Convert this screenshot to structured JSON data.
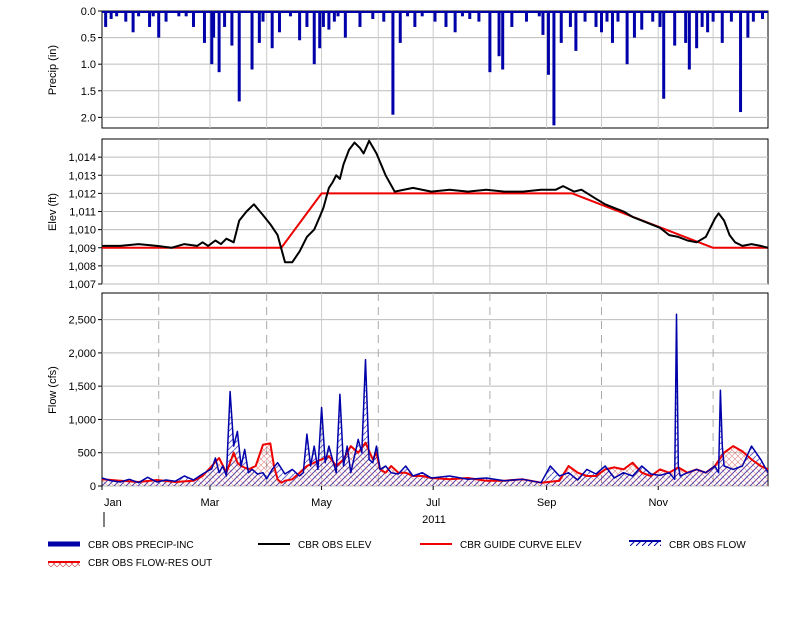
{
  "chart_data": [
    {
      "type": "bar",
      "panel": "precip",
      "ylabel": "Precip (in)",
      "ylim": [
        0,
        2.2
      ],
      "y_inverted": true,
      "yticks": [
        "0.0",
        "0.5",
        "1.0",
        "1.5",
        "2.0"
      ],
      "ytick_values": [
        0,
        0.5,
        1.0,
        1.5,
        2.0
      ],
      "series": [
        {
          "name": "CBR OBS PRECIP-INC",
          "color": "#0000aa",
          "x_day": [
            2,
            5,
            8,
            13,
            17,
            20,
            26,
            28,
            31,
            35,
            42,
            46,
            50,
            56,
            60,
            61,
            64,
            67,
            71,
            75,
            82,
            86,
            88,
            93,
            97,
            103,
            108,
            112,
            116,
            119,
            121,
            124,
            127,
            129,
            133,
            141,
            148,
            154,
            159,
            163,
            167,
            171,
            175,
            182,
            188,
            193,
            197,
            201,
            206,
            212,
            217,
            219,
            224,
            232,
            239,
            241,
            244,
            247,
            251,
            256,
            259,
            264,
            270,
            273,
            276,
            279,
            282,
            287,
            291,
            295,
            301,
            305,
            307,
            313,
            319,
            321,
            325,
            328,
            331,
            334,
            339,
            344,
            349,
            353,
            356,
            361
          ],
          "values": [
            0.3,
            0.15,
            0.1,
            0.2,
            0.4,
            0.1,
            0.3,
            0.1,
            0.5,
            0.2,
            0.1,
            0.1,
            0.3,
            0.6,
            1.0,
            0.5,
            1.15,
            0.3,
            0.65,
            1.7,
            1.1,
            0.6,
            0.2,
            0.7,
            0.4,
            0.1,
            0.55,
            0.3,
            1.0,
            0.7,
            0.3,
            0.35,
            0.2,
            0.1,
            0.5,
            0.3,
            0.15,
            0.2,
            1.95,
            0.6,
            0.1,
            0.3,
            0.1,
            0.2,
            0.3,
            0.4,
            0.1,
            0.15,
            0.2,
            1.15,
            0.85,
            1.1,
            0.3,
            0.2,
            0.1,
            0.45,
            1.2,
            2.15,
            0.6,
            0.3,
            0.75,
            0.2,
            0.3,
            0.4,
            0.2,
            0.6,
            0.2,
            1.0,
            0.5,
            0.35,
            0.2,
            0.3,
            1.65,
            0.65,
            0.6,
            1.1,
            0.7,
            0.3,
            0.4,
            0.2,
            0.6,
            0.2,
            1.9,
            0.5,
            0.2,
            0.15
          ]
        }
      ]
    },
    {
      "type": "line",
      "panel": "elev",
      "ylabel": "Elev (ft)",
      "ylim": [
        1007,
        1015
      ],
      "yticks": [
        "1,007",
        "1,008",
        "1,009",
        "1,010",
        "1,011",
        "1,012",
        "1,013",
        "1,014"
      ],
      "ytick_values": [
        1007,
        1008,
        1009,
        1010,
        1011,
        1012,
        1013,
        1014
      ],
      "series": [
        {
          "name": "CBR OBS ELEV",
          "color": "#000000",
          "x_day": [
            0,
            10,
            20,
            30,
            38,
            45,
            52,
            55,
            58,
            62,
            65,
            68,
            72,
            75,
            79,
            83,
            88,
            92,
            96,
            100,
            104,
            108,
            112,
            116,
            119,
            121,
            124,
            126,
            128,
            130,
            132,
            135,
            138,
            141,
            143,
            146,
            150,
            155,
            160,
            170,
            180,
            190,
            200,
            210,
            220,
            230,
            240,
            248,
            252,
            258,
            262,
            270,
            275,
            280,
            285,
            290,
            295,
            300,
            305,
            310,
            315,
            320,
            325,
            330,
            335,
            337,
            340,
            343,
            346,
            350,
            355,
            360,
            364
          ],
          "values": [
            1009.1,
            1009.1,
            1009.2,
            1009.1,
            1009.0,
            1009.2,
            1009.1,
            1009.3,
            1009.1,
            1009.4,
            1009.2,
            1009.5,
            1009.3,
            1010.5,
            1011.0,
            1011.4,
            1010.8,
            1010.3,
            1009.7,
            1008.2,
            1008.2,
            1008.8,
            1009.6,
            1010.0,
            1010.7,
            1011.2,
            1012.3,
            1012.6,
            1013.0,
            1012.8,
            1013.6,
            1014.4,
            1014.8,
            1014.5,
            1014.2,
            1014.9,
            1014.2,
            1013.0,
            1012.1,
            1012.3,
            1012.1,
            1012.2,
            1012.1,
            1012.2,
            1012.1,
            1012.1,
            1012.2,
            1012.2,
            1012.4,
            1012.1,
            1012.2,
            1011.7,
            1011.4,
            1011.2,
            1011.0,
            1010.7,
            1010.5,
            1010.3,
            1010.1,
            1009.7,
            1009.6,
            1009.4,
            1009.3,
            1009.6,
            1010.6,
            1010.9,
            1010.5,
            1009.7,
            1009.3,
            1009.1,
            1009.2,
            1009.1,
            1009.0
          ]
        },
        {
          "name": "CBR GUIDE CURVE ELEV",
          "color": "#ee0000",
          "x_day": [
            0,
            90,
            98,
            120,
            121,
            257,
            334,
            364
          ],
          "values": [
            1009,
            1009,
            1009,
            1012,
            1012,
            1012,
            1009,
            1009
          ]
        }
      ]
    },
    {
      "type": "line",
      "panel": "flow",
      "ylabel": "Flow (cfs)",
      "ylim": [
        0,
        2900
      ],
      "yticks": [
        "0",
        "500",
        "1,000",
        "1,500",
        "2,000",
        "2,500"
      ],
      "ytick_values": [
        0,
        500,
        1000,
        1500,
        2000,
        2500
      ],
      "xlabel": "2011",
      "xticks": [
        "Jan",
        "Mar",
        "May",
        "Jul",
        "Sep",
        "Nov"
      ],
      "xtick_days": [
        0,
        59,
        120,
        181,
        243,
        304
      ],
      "grid_days": [
        31,
        90,
        151,
        212,
        273,
        334
      ],
      "series": [
        {
          "name": "CBR OBS FLOW",
          "color": "#0000aa",
          "x_day": [
            0,
            5,
            10,
            15,
            20,
            25,
            30,
            35,
            40,
            45,
            50,
            55,
            60,
            62,
            64,
            66,
            68,
            70,
            72,
            74,
            76,
            78,
            80,
            82,
            85,
            88,
            90,
            93,
            96,
            100,
            104,
            108,
            110,
            112,
            114,
            116,
            118,
            120,
            122,
            124,
            126,
            128,
            130,
            132,
            134,
            136,
            138,
            140,
            142,
            144,
            146,
            148,
            150,
            152,
            155,
            158,
            162,
            166,
            170,
            175,
            180,
            190,
            200,
            210,
            220,
            230,
            240,
            245,
            250,
            255,
            260,
            265,
            270,
            275,
            280,
            285,
            290,
            295,
            300,
            305,
            310,
            313,
            314,
            315,
            316,
            320,
            325,
            330,
            335,
            337,
            338,
            339,
            340,
            345,
            350,
            355,
            360,
            364
          ],
          "values": [
            120,
            80,
            60,
            100,
            50,
            130,
            60,
            90,
            70,
            150,
            90,
            180,
            260,
            420,
            200,
            300,
            150,
            1420,
            600,
            820,
            300,
            550,
            200,
            250,
            180,
            200,
            110,
            250,
            350,
            180,
            250,
            150,
            200,
            780,
            300,
            600,
            250,
            1180,
            350,
            600,
            400,
            200,
            1380,
            300,
            600,
            200,
            450,
            700,
            500,
            1900,
            400,
            350,
            600,
            250,
            300,
            200,
            180,
            300,
            150,
            200,
            120,
            150,
            100,
            120,
            80,
            100,
            50,
            300,
            150,
            200,
            90,
            250,
            180,
            300,
            120,
            200,
            150,
            300,
            180,
            160,
            200,
            100,
            2580,
            300,
            150,
            200,
            250,
            200,
            300,
            200,
            1440,
            600,
            300,
            250,
            300,
            600,
            400,
            200
          ]
        },
        {
          "name": "CBR OBS FLOW-RES OUT",
          "color": "#ee0000",
          "x_day": [
            0,
            10,
            20,
            30,
            40,
            50,
            55,
            60,
            64,
            68,
            72,
            74,
            76,
            80,
            84,
            88,
            92,
            94,
            96,
            98,
            100,
            104,
            108,
            112,
            116,
            120,
            124,
            128,
            132,
            136,
            140,
            144,
            148,
            150,
            152,
            155,
            158,
            162,
            166,
            170,
            175,
            180,
            190,
            200,
            210,
            220,
            230,
            240,
            250,
            255,
            260,
            265,
            270,
            275,
            280,
            285,
            290,
            295,
            300,
            305,
            310,
            315,
            320,
            325,
            330,
            335,
            340,
            345,
            350,
            355,
            360,
            364
          ],
          "values": [
            100,
            80,
            60,
            90,
            60,
            80,
            150,
            300,
            420,
            200,
            500,
            350,
            300,
            250,
            300,
            620,
            640,
            300,
            100,
            50,
            80,
            100,
            200,
            300,
            350,
            400,
            450,
            300,
            400,
            600,
            500,
            650,
            400,
            500,
            250,
            200,
            300,
            200,
            200,
            150,
            150,
            120,
            100,
            120,
            80,
            80,
            100,
            50,
            80,
            300,
            200,
            150,
            150,
            250,
            280,
            250,
            350,
            200,
            150,
            250,
            200,
            280,
            200,
            250,
            200,
            300,
            500,
            600,
            520,
            400,
            300,
            250
          ]
        }
      ]
    }
  ],
  "legend": [
    {
      "name": "CBR OBS PRECIP-INC",
      "style": "thick-bar",
      "color": "#0000aa"
    },
    {
      "name": "CBR OBS ELEV",
      "style": "line",
      "color": "#000000"
    },
    {
      "name": "CBR GUIDE CURVE ELEV",
      "style": "line",
      "color": "#ee0000"
    },
    {
      "name": "CBR OBS FLOW",
      "style": "hatch-line",
      "color": "#0000aa"
    },
    {
      "name": "CBR OBS FLOW-RES OUT",
      "style": "hatch-line",
      "color": "#ee0000"
    }
  ]
}
